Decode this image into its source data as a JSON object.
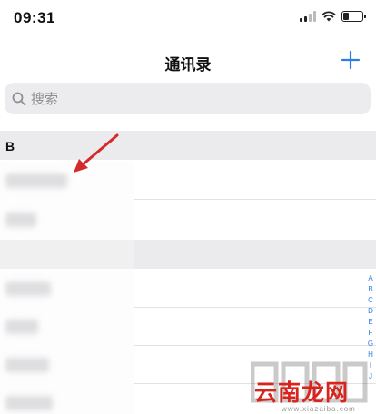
{
  "status_bar": {
    "time": "09:31",
    "battery_level": 0.3,
    "signal_bars_active": 2
  },
  "nav": {
    "title": "通讯录",
    "add_label": "+"
  },
  "search": {
    "placeholder": "搜索"
  },
  "sections": [
    {
      "letter": "B",
      "rows": [
        {
          "name": ""
        },
        {
          "name": ""
        }
      ]
    },
    {
      "letter": "",
      "rows": [
        {
          "name": ""
        },
        {
          "name": ""
        },
        {
          "name": ""
        },
        {
          "name": ""
        }
      ]
    }
  ],
  "index_letters": [
    "A",
    "B",
    "C",
    "D",
    "E",
    "F",
    "G",
    "H",
    "I",
    "J"
  ],
  "watermark": {
    "site_name": "云南龙网",
    "url": "www.xiazaiba.com"
  },
  "colors": {
    "accent": "#2f7de1",
    "annotation": "#d42a2a",
    "watermark_red": "#d8241d"
  }
}
